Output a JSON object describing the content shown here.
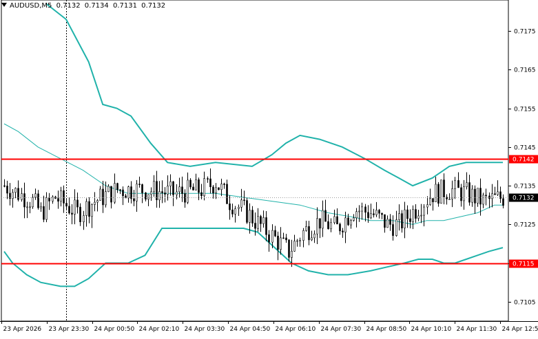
{
  "header": {
    "symbol": "AUDUSD,M5",
    "open": "0.7132",
    "high": "0.7134",
    "low": "0.7131",
    "close": "0.7132"
  },
  "colors": {
    "band": "#20b2aa",
    "level": "#ff0000",
    "candle": "#000000",
    "current_price_bg": "#000000",
    "current_price_text": "#ffffff"
  },
  "chart_data": {
    "type": "candlestick",
    "symbol": "AUDUSD",
    "timeframe": "M5",
    "ylim": [
      0.71,
      0.7183
    ],
    "y_ticks": [
      "0.7175",
      "0.7165",
      "0.7155",
      "0.7145",
      "0.7135",
      "0.7125",
      "0.7115",
      "0.7105"
    ],
    "x_ticks": [
      "23 Apr 2026",
      "23 Apr 23:30",
      "24 Apr 00:50",
      "24 Apr 02:10",
      "24 Apr 03:30",
      "24 Apr 04:50",
      "24 Apr 06:10",
      "24 Apr 07:30",
      "24 Apr 08:50",
      "24 Apr 10:10",
      "24 Apr 11:30",
      "24 Apr 12:50"
    ],
    "bar_count": 178,
    "horizontal_levels": [
      {
        "value": 0.7142,
        "label": "0.7142",
        "color": "#ff0000"
      },
      {
        "value": 0.7115,
        "label": "0.7115",
        "color": "#ff0000"
      }
    ],
    "current_price": {
      "value": 0.7132,
      "label": "0.7132"
    },
    "crosshair_x_bar": 22,
    "close_path": [
      [
        0,
        0.7135
      ],
      [
        10,
        0.7131
      ],
      [
        13,
        0.7128
      ],
      [
        18,
        0.7132
      ],
      [
        22,
        0.713
      ],
      [
        26,
        0.7128
      ],
      [
        32,
        0.7131
      ],
      [
        40,
        0.7134
      ],
      [
        50,
        0.7134
      ],
      [
        60,
        0.7133
      ],
      [
        70,
        0.7134
      ],
      [
        75,
        0.7136
      ],
      [
        80,
        0.7131
      ],
      [
        86,
        0.7128
      ],
      [
        92,
        0.7124
      ],
      [
        98,
        0.712
      ],
      [
        101,
        0.7118
      ],
      [
        106,
        0.7123
      ],
      [
        112,
        0.7126
      ],
      [
        118,
        0.7124
      ],
      [
        124,
        0.7129
      ],
      [
        130,
        0.7128
      ],
      [
        136,
        0.7125
      ],
      [
        140,
        0.7125
      ],
      [
        146,
        0.7129
      ],
      [
        152,
        0.7133
      ],
      [
        158,
        0.7134
      ],
      [
        164,
        0.7133
      ],
      [
        170,
        0.7131
      ],
      [
        177,
        0.7132
      ]
    ],
    "series": [
      {
        "name": "Upper band",
        "color": "#20b2aa",
        "points": [
          [
            15,
            0.7182
          ],
          [
            22,
            0.7178
          ],
          [
            30,
            0.7167
          ],
          [
            35,
            0.7156
          ],
          [
            40,
            0.7155
          ],
          [
            45,
            0.7153
          ],
          [
            52,
            0.7146
          ],
          [
            58,
            0.7141
          ],
          [
            66,
            0.714
          ],
          [
            75,
            0.7141
          ],
          [
            88,
            0.714
          ],
          [
            95,
            0.7143
          ],
          [
            100,
            0.7146
          ],
          [
            105,
            0.7148
          ],
          [
            112,
            0.7147
          ],
          [
            120,
            0.7145
          ],
          [
            128,
            0.7142
          ],
          [
            135,
            0.7139
          ],
          [
            140,
            0.7137
          ],
          [
            145,
            0.7135
          ],
          [
            152,
            0.7137
          ],
          [
            158,
            0.714
          ],
          [
            164,
            0.7141
          ],
          [
            170,
            0.7141
          ],
          [
            177,
            0.7141
          ]
        ]
      },
      {
        "name": "Middle band",
        "color": "#20b2aa",
        "points": [
          [
            0,
            0.7151
          ],
          [
            5,
            0.7149
          ],
          [
            12,
            0.7145
          ],
          [
            20,
            0.7142
          ],
          [
            28,
            0.7139
          ],
          [
            36,
            0.7135
          ],
          [
            44,
            0.7133
          ],
          [
            55,
            0.7133
          ],
          [
            65,
            0.7133
          ],
          [
            75,
            0.7133
          ],
          [
            85,
            0.7132
          ],
          [
            95,
            0.7131
          ],
          [
            105,
            0.713
          ],
          [
            115,
            0.7128
          ],
          [
            123,
            0.7127
          ],
          [
            130,
            0.7126
          ],
          [
            138,
            0.7126
          ],
          [
            145,
            0.7125
          ],
          [
            150,
            0.7126
          ],
          [
            156,
            0.7126
          ],
          [
            162,
            0.7127
          ],
          [
            168,
            0.7128
          ],
          [
            174,
            0.713
          ],
          [
            177,
            0.713
          ]
        ]
      },
      {
        "name": "Lower band",
        "color": "#20b2aa",
        "points": [
          [
            0,
            0.7118
          ],
          [
            3,
            0.7115
          ],
          [
            8,
            0.7112
          ],
          [
            13,
            0.711
          ],
          [
            20,
            0.7109
          ],
          [
            25,
            0.7109
          ],
          [
            30,
            0.7111
          ],
          [
            36,
            0.7115
          ],
          [
            44,
            0.7115
          ],
          [
            50,
            0.7117
          ],
          [
            56,
            0.7124
          ],
          [
            65,
            0.7124
          ],
          [
            75,
            0.7124
          ],
          [
            85,
            0.7124
          ],
          [
            90,
            0.7123
          ],
          [
            96,
            0.7119
          ],
          [
            102,
            0.7115
          ],
          [
            108,
            0.7113
          ],
          [
            115,
            0.7112
          ],
          [
            122,
            0.7112
          ],
          [
            130,
            0.7113
          ],
          [
            136,
            0.7114
          ],
          [
            142,
            0.7115
          ],
          [
            147,
            0.7116
          ],
          [
            152,
            0.7116
          ],
          [
            156,
            0.7115
          ],
          [
            160,
            0.7115
          ],
          [
            164,
            0.7116
          ],
          [
            168,
            0.7117
          ],
          [
            172,
            0.7118
          ],
          [
            177,
            0.7119
          ]
        ]
      }
    ]
  }
}
